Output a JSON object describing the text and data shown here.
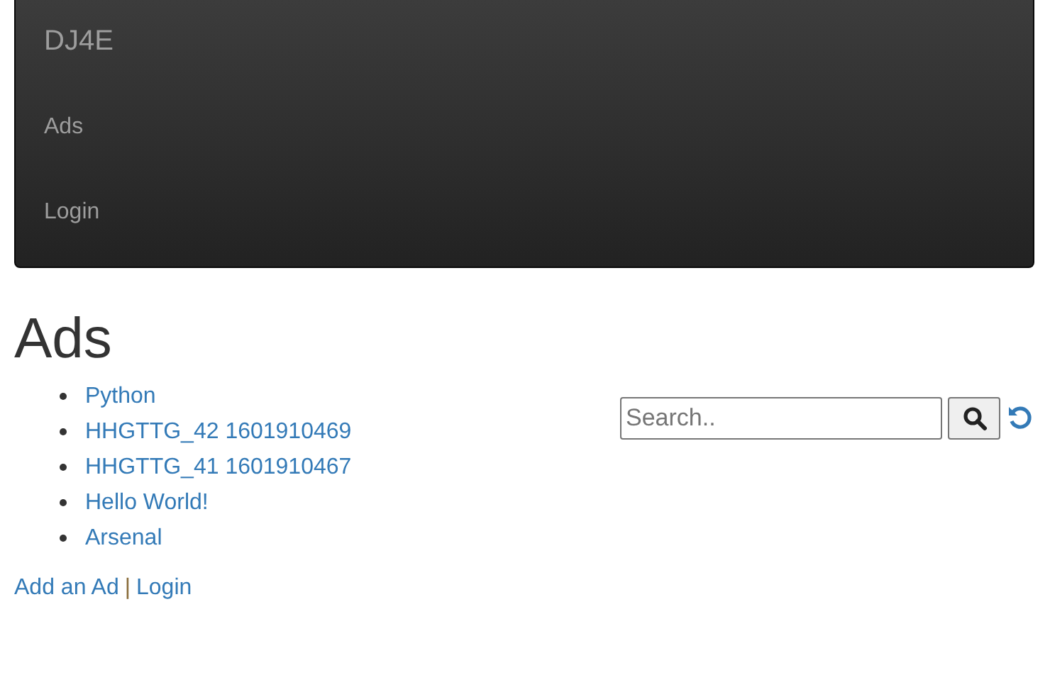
{
  "navbar": {
    "brand": "DJ4E",
    "items": [
      "Ads",
      "Login"
    ]
  },
  "heading": "Ads",
  "ads": [
    "Python",
    "HHGTTG_42 1601910469",
    "HHGTTG_41 1601910467",
    "Hello World!",
    "Arsenal"
  ],
  "search": {
    "placeholder": "Search.."
  },
  "footer": {
    "links": [
      "Add an Ad",
      "Login"
    ],
    "separator": "|"
  }
}
